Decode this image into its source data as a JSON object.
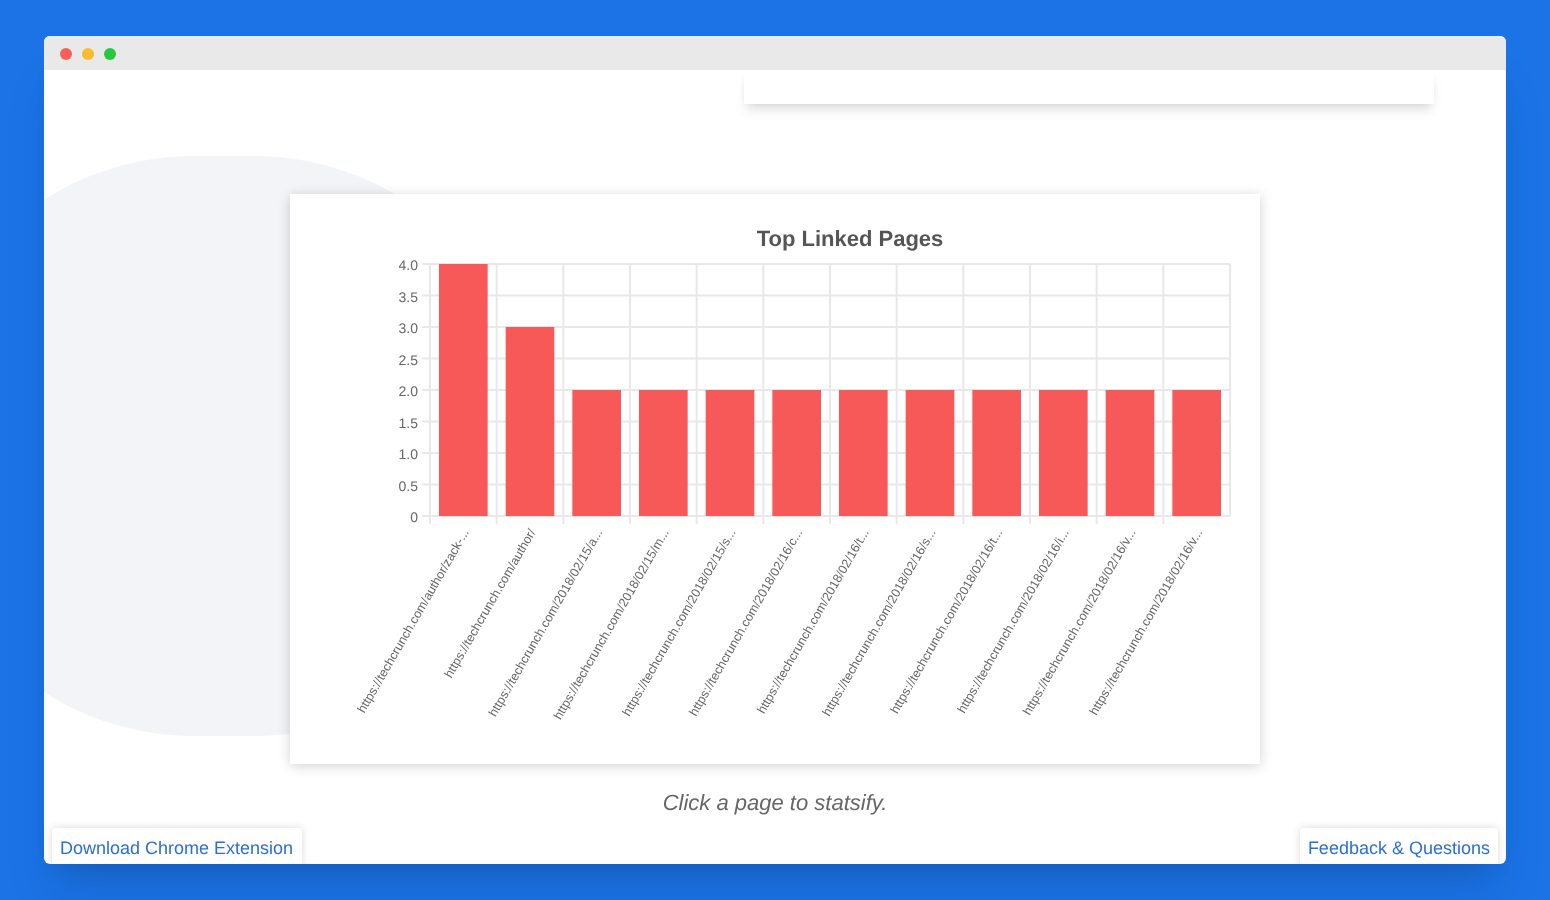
{
  "chart": {
    "chart_data": {
      "type": "bar",
      "title": "Top Linked Pages",
      "grid": true,
      "categories": [
        "https://techcrunch.com/author/zack-...",
        "https://techcrunch.com/author/",
        "https://techcrunch.com/2018/02/15/a...",
        "https://techcrunch.com/2018/02/15/m...",
        "https://techcrunch.com/2018/02/15/s...",
        "https://techcrunch.com/2018/02/16/c...",
        "https://techcrunch.com/2018/02/16/t...",
        "https://techcrunch.com/2018/02/16/s...",
        "https://techcrunch.com/2018/02/16/t...",
        "https://techcrunch.com/2018/02/16/i...",
        "https://techcrunch.com/2018/02/16/v...",
        "https://techcrunch.com/2018/02/16/v..."
      ],
      "series": [
        {
          "color": "#f75858",
          "values": [
            4,
            3,
            2,
            2,
            2,
            2,
            2,
            2,
            2,
            2,
            2,
            2
          ]
        }
      ],
      "ylim": [
        0,
        4
      ],
      "yticks": [
        {
          "value": 0,
          "label": "0"
        },
        {
          "value": 0.5,
          "label": "0.5"
        },
        {
          "value": 1,
          "label": "1.0"
        },
        {
          "value": 1.5,
          "label": "1.5"
        },
        {
          "value": 2,
          "label": "2.0"
        },
        {
          "value": 2.5,
          "label": "2.5"
        },
        {
          "value": 3,
          "label": "3.0"
        },
        {
          "value": 3.5,
          "label": "3.5"
        },
        {
          "value": 4,
          "label": "4.0"
        }
      ]
    }
  },
  "caption": "Click a page to statsify.",
  "footer": {
    "left_link": "Download Chrome Extension",
    "right_link": "Feedback & Questions"
  }
}
